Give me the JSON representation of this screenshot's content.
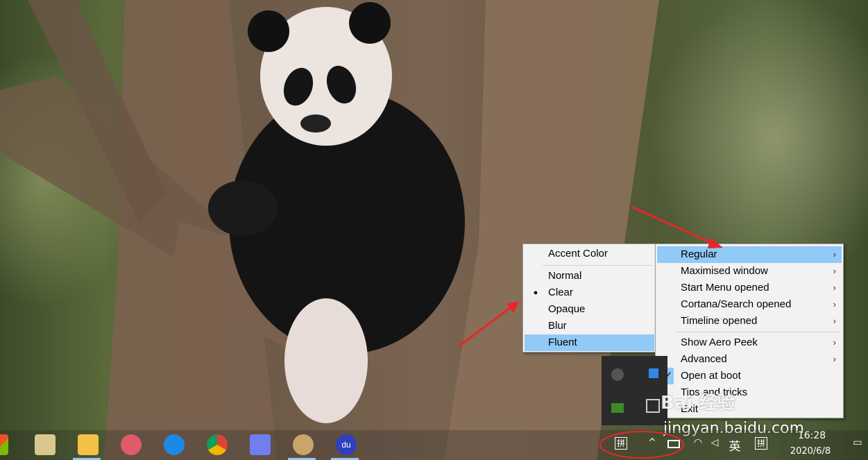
{
  "wallpaper": {
    "subject": "panda-in-tree"
  },
  "left_menu": {
    "header": "Accent Color",
    "items": [
      {
        "label": "Normal",
        "selected": false,
        "highlighted": false
      },
      {
        "label": "Clear",
        "selected": true,
        "highlighted": false
      },
      {
        "label": "Opaque",
        "selected": false,
        "highlighted": false
      },
      {
        "label": "Blur",
        "selected": false,
        "highlighted": false
      },
      {
        "label": "Fluent",
        "selected": false,
        "highlighted": true
      }
    ]
  },
  "right_menu": {
    "group1": [
      {
        "label": "Regular",
        "has_submenu": true,
        "highlighted": true
      },
      {
        "label": "Maximised window",
        "has_submenu": true
      },
      {
        "label": "Start Menu opened",
        "has_submenu": true
      },
      {
        "label": "Cortana/Search opened",
        "has_submenu": true
      },
      {
        "label": "Timeline opened",
        "has_submenu": true
      }
    ],
    "group2": [
      {
        "label": "Show Aero Peek",
        "has_submenu": true
      },
      {
        "label": "Advanced",
        "has_submenu": true
      },
      {
        "label": "Open at boot",
        "checked": true
      },
      {
        "label": "Tips and tricks"
      },
      {
        "label": "Exit"
      }
    ]
  },
  "submenu_arrow": "›",
  "checkmark": "✓",
  "bullet": "●",
  "taskbar": {
    "apps": [
      "windows-icon",
      "notepad-icon",
      "file-explorer-icon",
      "snipping-tool-icon",
      "edge-icon",
      "chrome-icon",
      "feishu-icon",
      "paint-icon",
      "baidu-icon"
    ],
    "baidu_label": "du",
    "tray": {
      "ime_left": "拼",
      "chevron": "^",
      "lang": "英",
      "ime_right": "拼",
      "time": "16:28",
      "date": "2020/6/8"
    }
  },
  "watermark": {
    "brand": "Bai 经验",
    "url": "jingyan.baidu.com"
  },
  "colors": {
    "highlight": "#91c9f7",
    "menu_bg": "#f2f2f2",
    "annotation": "#e8262a"
  }
}
